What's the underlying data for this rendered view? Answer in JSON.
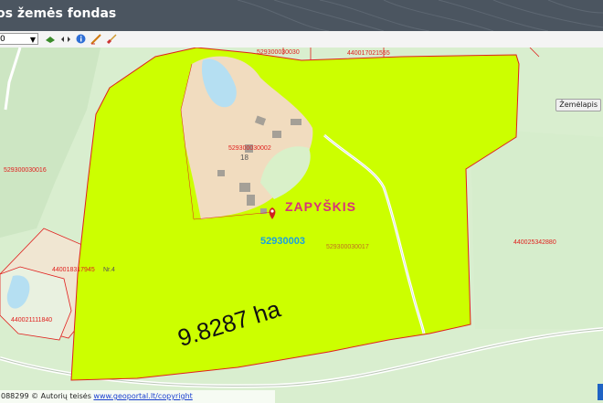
{
  "header": {
    "title": "os žemės fondas"
  },
  "toolbar": {
    "scale_value": "0",
    "buttons": [
      {
        "icon": "layers-icon"
      },
      {
        "icon": "navigate-arrows-icon"
      },
      {
        "icon": "info-icon"
      },
      {
        "icon": "measure-icon"
      },
      {
        "icon": "brush-icon"
      }
    ]
  },
  "map": {
    "basemap_button": "Žemėlapis",
    "place_name": "ZAPYŠKIS",
    "cadastral_area": "52930003",
    "area_label": "9.8287 ha",
    "parcels": [
      "529300030030",
      "440017021555",
      "529300030002",
      "18",
      "529300030016",
      "529300030017",
      "440025342880",
      "440018317945",
      "Nr.4",
      "440021111840"
    ]
  },
  "footer": {
    "left_text": "088299",
    "copyright_prefix": "© Autorių teisės",
    "copyright_link": "www.geoportal.lt/copyright"
  },
  "colors": {
    "highlight": "#ccff00",
    "parcel_border": "#e0201e",
    "header": "#4b5560"
  }
}
